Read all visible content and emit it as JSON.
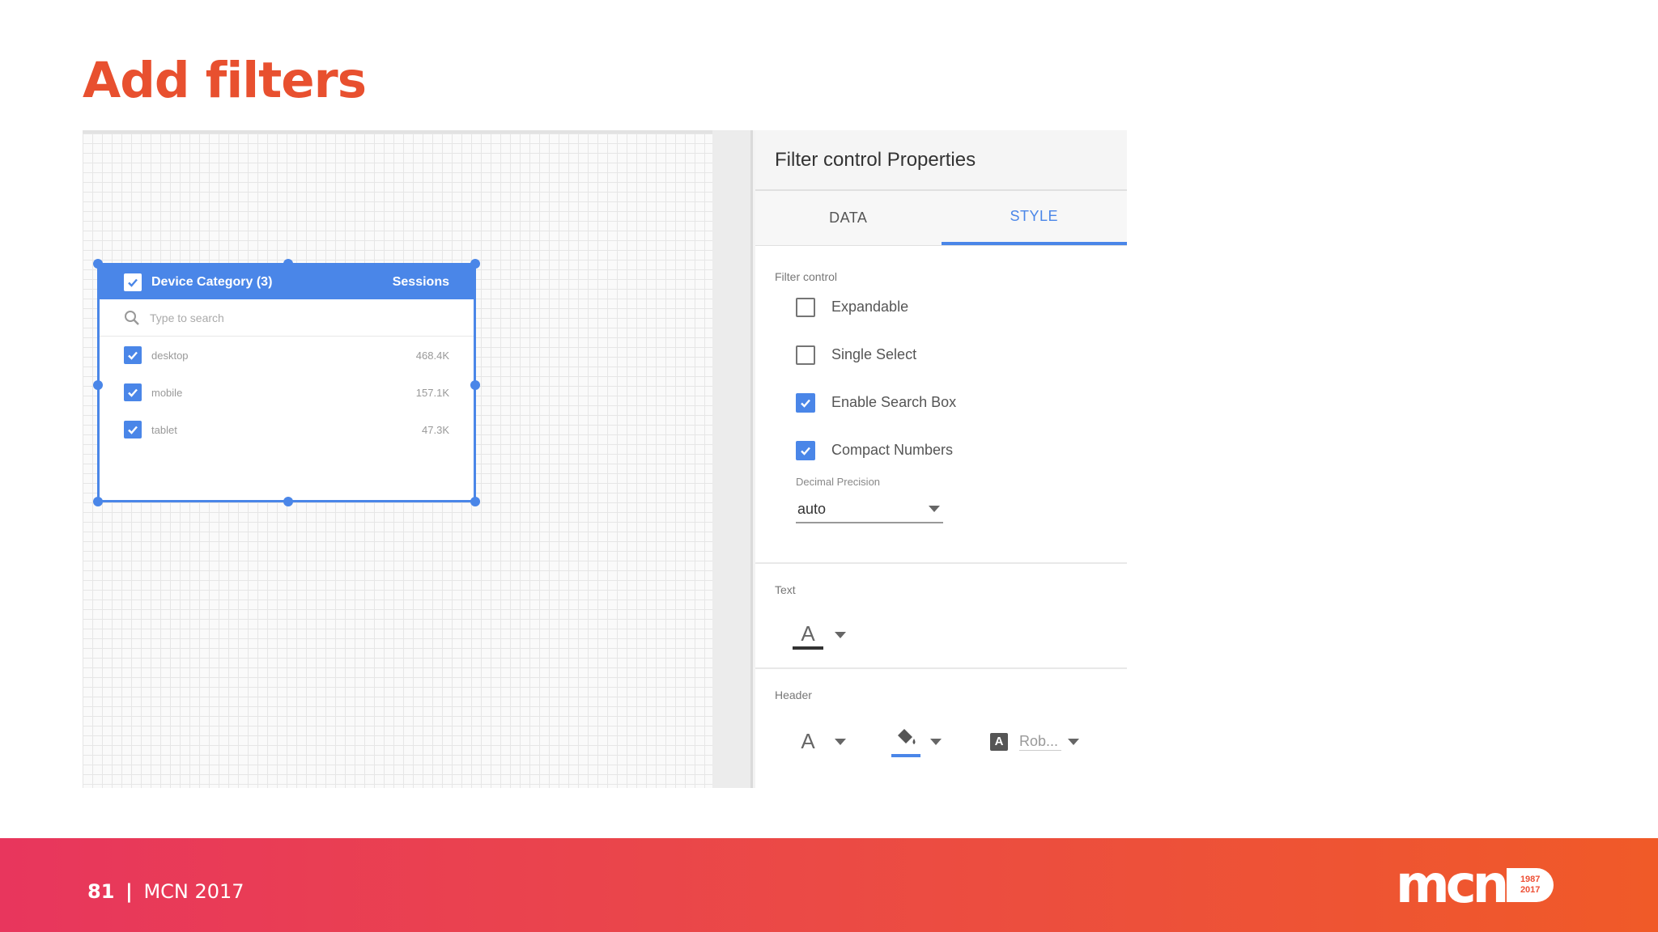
{
  "slide": {
    "title": "Add filters",
    "page_number": "81",
    "separator": "|",
    "event": "MCN 2017"
  },
  "logo": {
    "text": "mcn",
    "badge_top": "1987",
    "badge_bottom": "2017"
  },
  "filter_widget": {
    "title": "Device Category (3)",
    "metric": "Sessions",
    "search_placeholder": "Type to search",
    "rows": [
      {
        "label": "desktop",
        "value": "468.4K",
        "checked": true
      },
      {
        "label": "mobile",
        "value": "157.1K",
        "checked": true
      },
      {
        "label": "tablet",
        "value": "47.3K",
        "checked": true
      }
    ]
  },
  "panel": {
    "title": "Filter control Properties",
    "tabs": [
      {
        "label": "DATA",
        "active": false
      },
      {
        "label": "STYLE",
        "active": true
      }
    ],
    "filter_control": {
      "section_label": "Filter control",
      "options": [
        {
          "label": "Expandable",
          "checked": false
        },
        {
          "label": "Single Select",
          "checked": false
        },
        {
          "label": "Enable Search Box",
          "checked": true
        },
        {
          "label": "Compact Numbers",
          "checked": true
        }
      ],
      "precision_label": "Decimal Precision",
      "precision_value": "auto"
    },
    "text_section": {
      "label": "Text",
      "font_glyph": "A"
    },
    "header_section": {
      "label": "Header",
      "font_glyph": "A",
      "font_family_badge": "A",
      "font_family_value": "Rob..."
    }
  },
  "colors": {
    "accent_blue": "#4a86e8",
    "title_orange": "#e8502f",
    "footer_start": "#e8365d",
    "footer_end": "#f05a28"
  }
}
